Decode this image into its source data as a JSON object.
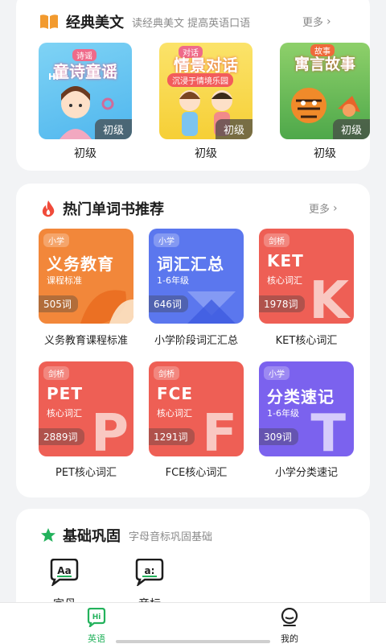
{
  "classics": {
    "title": "经典美文",
    "subtitle": "读经典美文 提高英语口语",
    "more": "更多",
    "items": [
      {
        "caption": "初级",
        "badge": "初级",
        "cover_title": "童诗童谣",
        "cover_tag": "诗谣",
        "cover_small": "Hi"
      },
      {
        "caption": "初级",
        "badge": "初级",
        "cover_title": "情景对话",
        "cover_tag": "对话",
        "cover_sub": "沉浸于情境乐园"
      },
      {
        "caption": "初级",
        "badge": "初级",
        "cover_title": "寓言故事",
        "cover_tag": "故事"
      }
    ]
  },
  "books": {
    "title": "热门单词书推荐",
    "more": "更多",
    "items": [
      {
        "tag": "小学",
        "title": "义务教育",
        "sub": "课程标准",
        "count": "505词",
        "caption": "义务教育课程标准",
        "color": "#f2873a"
      },
      {
        "tag": "小学",
        "title": "词汇汇总",
        "sub": "1-6年级",
        "count": "646词",
        "caption": "小学阶段词汇汇总",
        "color": "#5b77ee",
        "letter": ""
      },
      {
        "tag": "剑桥",
        "title": "KET",
        "sub": "核心词汇",
        "count": "1978词",
        "caption": "KET核心词汇",
        "color": "#ee5f55",
        "letter": "K"
      },
      {
        "tag": "剑桥",
        "title": "PET",
        "sub": "核心词汇",
        "count": "2889词",
        "caption": "PET核心词汇",
        "color": "#ee5f55",
        "letter": "P"
      },
      {
        "tag": "剑桥",
        "title": "FCE",
        "sub": "核心词汇",
        "count": "1291词",
        "caption": "FCE核心词汇",
        "color": "#ee5f55",
        "letter": "F"
      },
      {
        "tag": "小学",
        "title": "分类速记",
        "sub": "1-6年级",
        "count": "309词",
        "caption": "小学分类速记",
        "color": "#7b62ee",
        "letter": "T"
      }
    ]
  },
  "basics": {
    "title": "基础巩固",
    "subtitle": "字母音标巩固基础",
    "items": [
      {
        "label": "字母",
        "icon_text": "Aa"
      },
      {
        "label": "音标",
        "icon_text": "a:"
      }
    ]
  },
  "tabs": [
    {
      "label": "英语",
      "icon_text": "Hi",
      "active": true
    },
    {
      "label": "我的",
      "active": false
    }
  ],
  "colors": {
    "accent": "#23b25c",
    "inactive": "#222222"
  }
}
